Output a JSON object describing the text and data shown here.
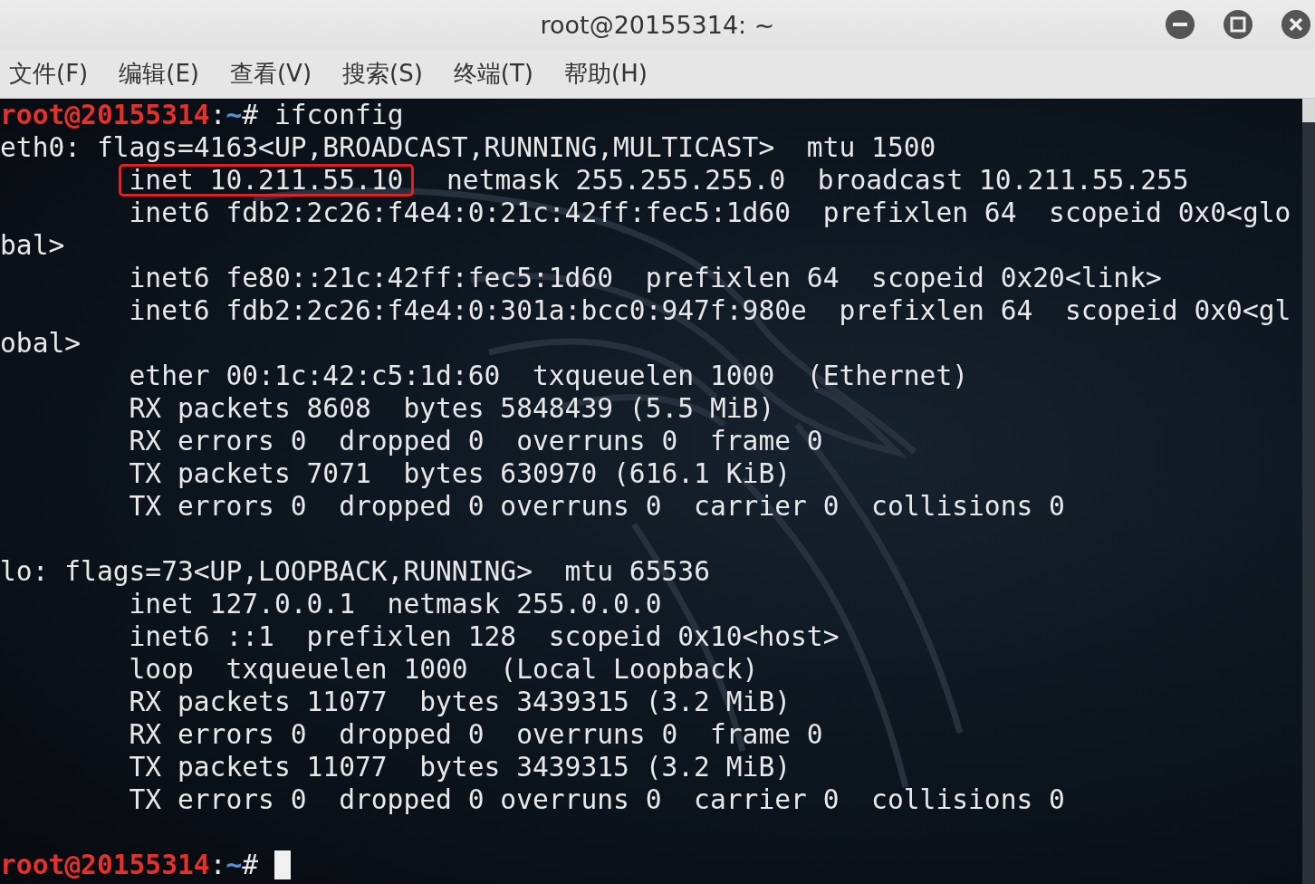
{
  "window": {
    "title": "root@20155314: ~"
  },
  "menu": [
    "文件(F)",
    "编辑(E)",
    "查看(V)",
    "搜索(S)",
    "终端(T)",
    "帮助(H)"
  ],
  "terminal": {
    "lines": [
      {
        "kind": "prompt",
        "user": "root@20155314",
        "separator": ":",
        "path": "~",
        "symbol": "# ",
        "command": "ifconfig",
        "cursor": false
      },
      {
        "kind": "output",
        "indent": false,
        "segments": [
          {
            "text": "eth0: flags=4163<UP,BROADCAST,RUNNING,MULTICAST>  mtu 1500",
            "boxed": false
          }
        ]
      },
      {
        "kind": "output",
        "indent": true,
        "segments": [
          {
            "text": "inet 10.211.55.10",
            "boxed": true
          },
          {
            "text": "  netmask 255.255.255.0  broadcast 10.211.55.255",
            "boxed": false
          }
        ]
      },
      {
        "kind": "output",
        "indent": true,
        "segments": [
          {
            "text": "inet6 fdb2:2c26:f4e4:0:21c:42ff:fec5:1d60  prefixlen 64  scopeid 0x0<glo",
            "boxed": false
          }
        ]
      },
      {
        "kind": "output",
        "indent": false,
        "segments": [
          {
            "text": "bal>",
            "boxed": false
          }
        ]
      },
      {
        "kind": "output",
        "indent": true,
        "segments": [
          {
            "text": "inet6 fe80::21c:42ff:fec5:1d60  prefixlen 64  scopeid 0x20<link>",
            "boxed": false
          }
        ]
      },
      {
        "kind": "output",
        "indent": true,
        "segments": [
          {
            "text": "inet6 fdb2:2c26:f4e4:0:301a:bcc0:947f:980e  prefixlen 64  scopeid 0x0<gl",
            "boxed": false
          }
        ]
      },
      {
        "kind": "output",
        "indent": false,
        "segments": [
          {
            "text": "obal>",
            "boxed": false
          }
        ]
      },
      {
        "kind": "output",
        "indent": true,
        "segments": [
          {
            "text": "ether 00:1c:42:c5:1d:60  txqueuelen 1000  (Ethernet)",
            "boxed": false
          }
        ]
      },
      {
        "kind": "output",
        "indent": true,
        "segments": [
          {
            "text": "RX packets 8608  bytes 5848439 (5.5 MiB)",
            "boxed": false
          }
        ]
      },
      {
        "kind": "output",
        "indent": true,
        "segments": [
          {
            "text": "RX errors 0  dropped 0  overruns 0  frame 0",
            "boxed": false
          }
        ]
      },
      {
        "kind": "output",
        "indent": true,
        "segments": [
          {
            "text": "TX packets 7071  bytes 630970 (616.1 KiB)",
            "boxed": false
          }
        ]
      },
      {
        "kind": "output",
        "indent": true,
        "segments": [
          {
            "text": "TX errors 0  dropped 0 overruns 0  carrier 0  collisions 0",
            "boxed": false
          }
        ]
      },
      {
        "kind": "blank"
      },
      {
        "kind": "output",
        "indent": false,
        "segments": [
          {
            "text": "lo: flags=73<UP,LOOPBACK,RUNNING>  mtu 65536",
            "boxed": false
          }
        ]
      },
      {
        "kind": "output",
        "indent": true,
        "segments": [
          {
            "text": "inet 127.0.0.1  netmask 255.0.0.0",
            "boxed": false
          }
        ]
      },
      {
        "kind": "output",
        "indent": true,
        "segments": [
          {
            "text": "inet6 ::1  prefixlen 128  scopeid 0x10<host>",
            "boxed": false
          }
        ]
      },
      {
        "kind": "output",
        "indent": true,
        "segments": [
          {
            "text": "loop  txqueuelen 1000  (Local Loopback)",
            "boxed": false
          }
        ]
      },
      {
        "kind": "output",
        "indent": true,
        "segments": [
          {
            "text": "RX packets 11077  bytes 3439315 (3.2 MiB)",
            "boxed": false
          }
        ]
      },
      {
        "kind": "output",
        "indent": true,
        "segments": [
          {
            "text": "RX errors 0  dropped 0  overruns 0  frame 0",
            "boxed": false
          }
        ]
      },
      {
        "kind": "output",
        "indent": true,
        "segments": [
          {
            "text": "TX packets 11077  bytes 3439315 (3.2 MiB)",
            "boxed": false
          }
        ]
      },
      {
        "kind": "output",
        "indent": true,
        "segments": [
          {
            "text": "TX errors 0  dropped 0 overruns 0  carrier 0  collisions 0",
            "boxed": false
          }
        ]
      },
      {
        "kind": "blank"
      },
      {
        "kind": "prompt",
        "user": "root@20155314",
        "separator": ":",
        "path": "~",
        "symbol": "# ",
        "cursor": true
      }
    ]
  }
}
